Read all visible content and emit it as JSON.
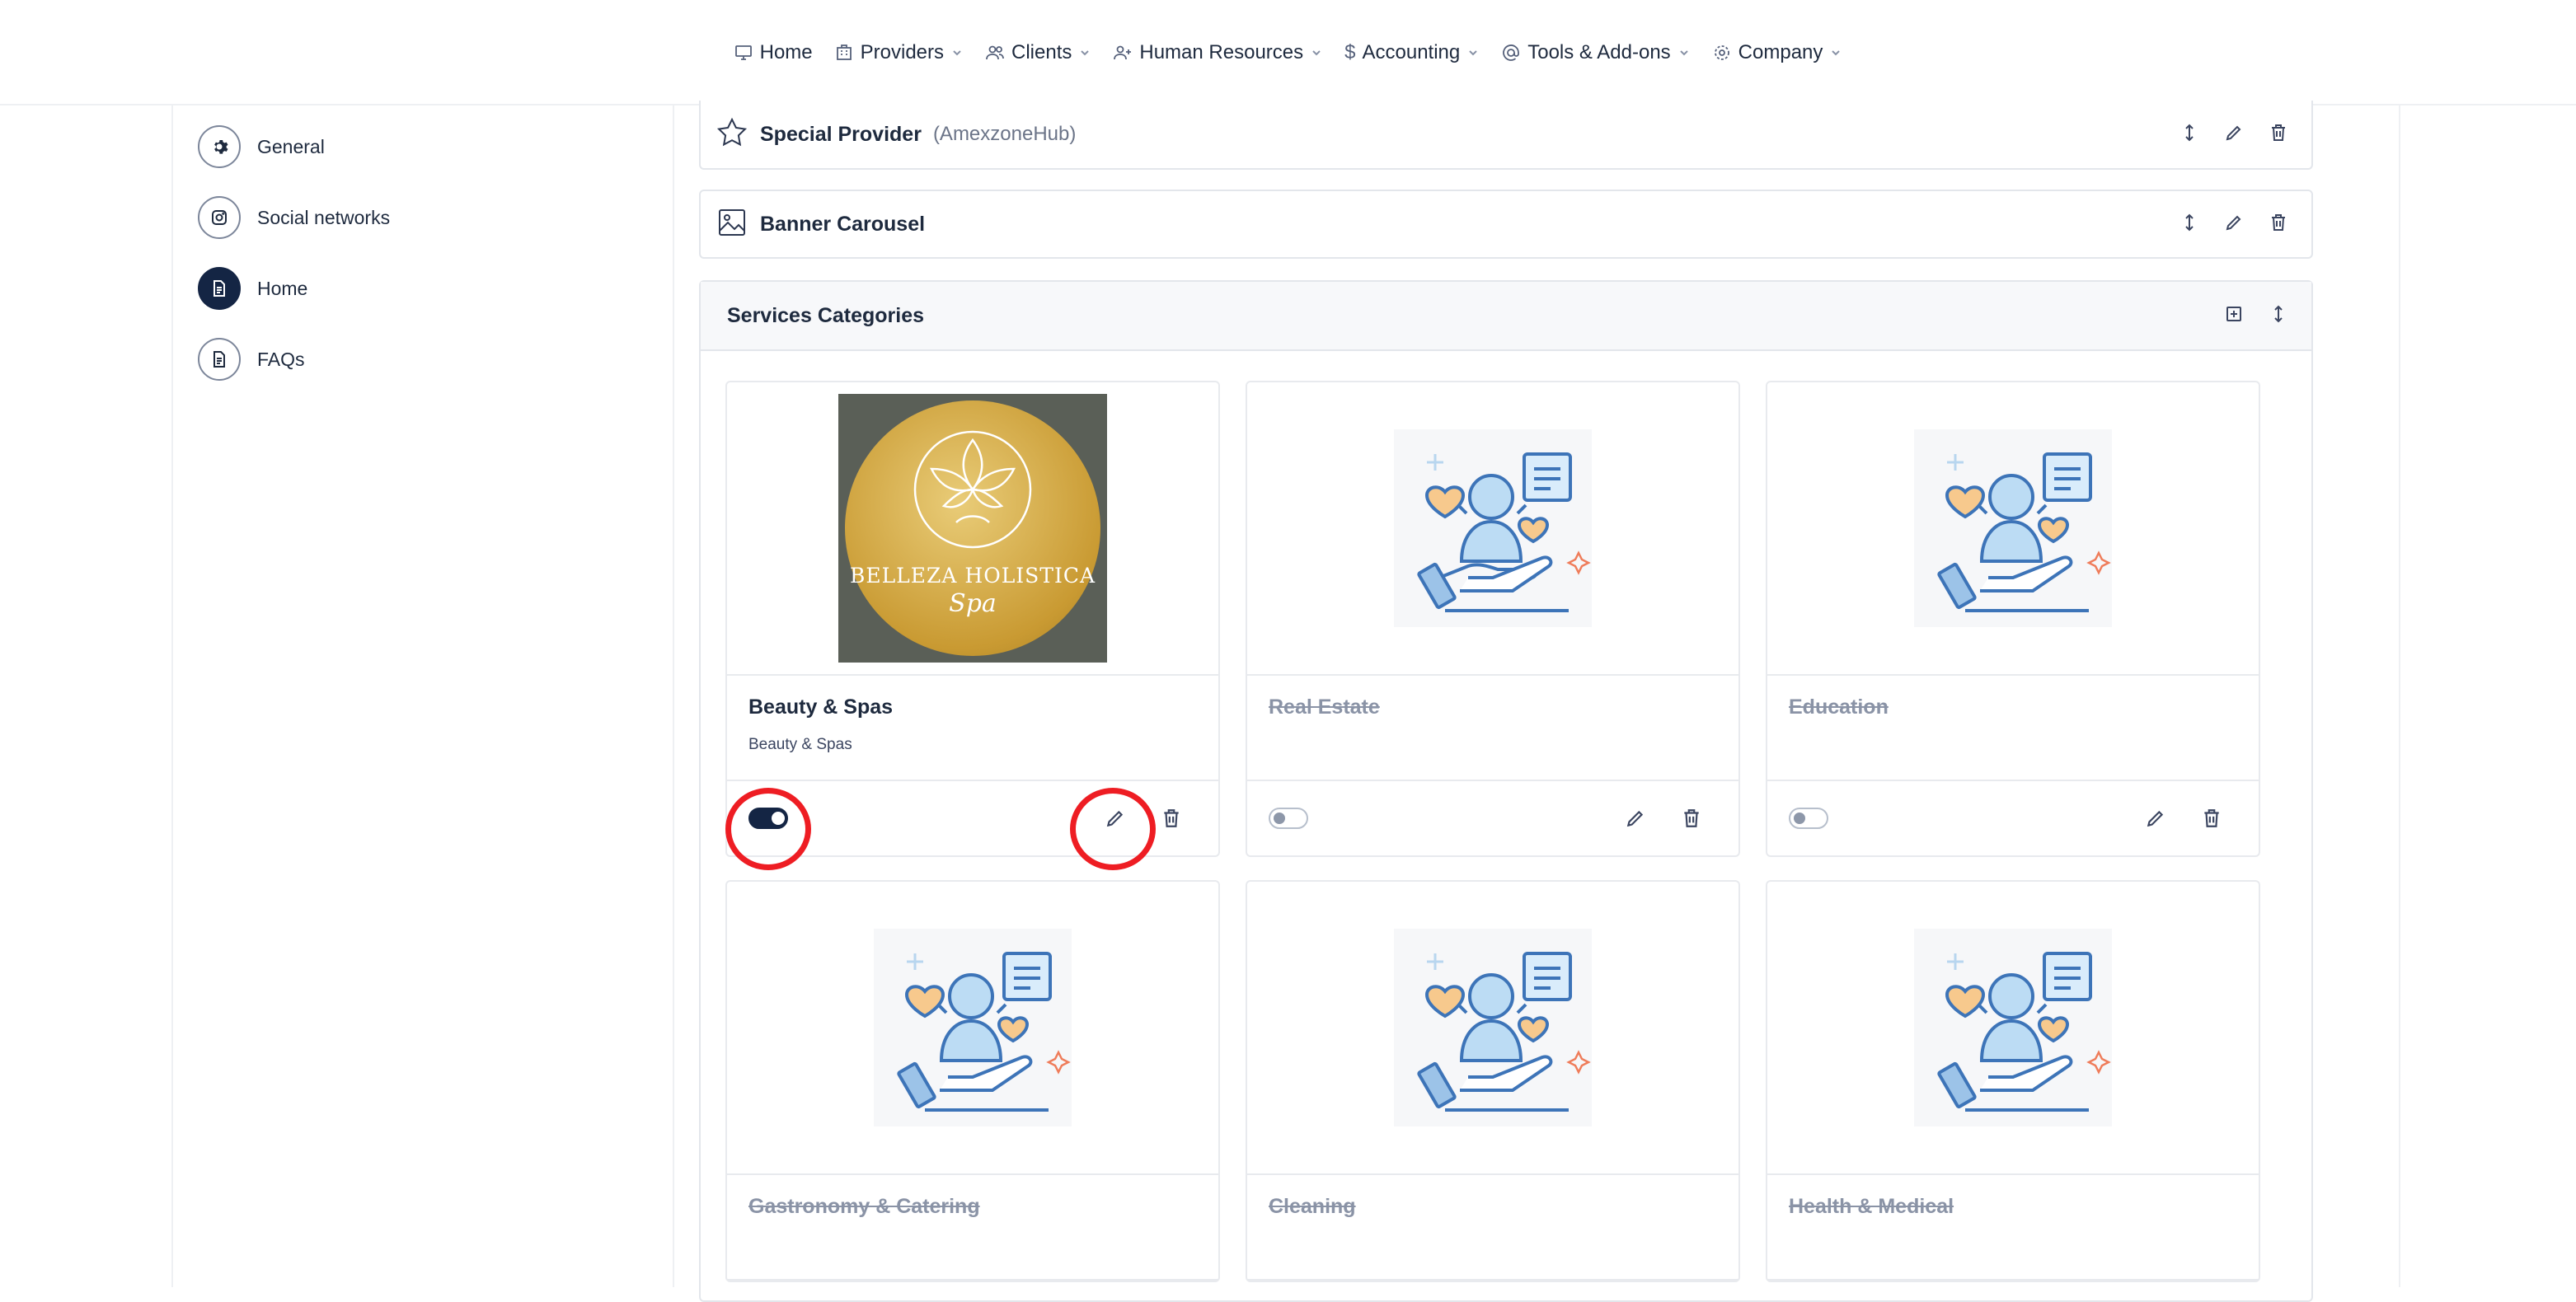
{
  "nav": {
    "items": [
      {
        "label": "Home",
        "icon": "monitor-icon",
        "dropdown": false
      },
      {
        "label": "Providers",
        "icon": "building-icon",
        "dropdown": true
      },
      {
        "label": "Clients",
        "icon": "users-icon",
        "dropdown": true
      },
      {
        "label": "Human Resources",
        "icon": "user-plus-icon",
        "dropdown": true
      },
      {
        "label": "Accounting",
        "icon": "dollar-icon",
        "dropdown": true
      },
      {
        "label": "Tools & Add-ons",
        "icon": "at-icon",
        "dropdown": true
      },
      {
        "label": "Company",
        "icon": "gear-icon",
        "dropdown": true
      }
    ],
    "dollar_glyph": "$"
  },
  "sidebar": {
    "items": [
      {
        "label": "General",
        "icon": "gear-icon",
        "active": false
      },
      {
        "label": "Social networks",
        "icon": "instagram-icon",
        "active": false
      },
      {
        "label": "Home",
        "icon": "document-icon",
        "active": true
      },
      {
        "label": "FAQs",
        "icon": "document-icon",
        "active": false
      }
    ]
  },
  "sections": {
    "special_provider": {
      "title": "Special Provider",
      "subtitle": "(AmexzoneHub)",
      "icon": "star-icon"
    },
    "banner_carousel": {
      "title": "Banner Carousel",
      "icon": "image-icon"
    },
    "services_categories": {
      "title": "Services Categories",
      "icon": "align-left-icon"
    }
  },
  "cards": [
    {
      "title": "Beauty & Spas",
      "subtitle": "Beauty & Spas",
      "enabled": true,
      "image": "belleza-holistica-logo"
    },
    {
      "title": "Real Estate",
      "subtitle": "",
      "enabled": false,
      "image": "service-illustration"
    },
    {
      "title": "Education",
      "subtitle": "",
      "enabled": false,
      "image": "service-illustration"
    },
    {
      "title": "Gastronomy & Catering",
      "subtitle": "",
      "enabled": false,
      "image": "service-illustration"
    },
    {
      "title": "Cleaning",
      "subtitle": "",
      "enabled": false,
      "image": "service-illustration"
    },
    {
      "title": "Health & Medical",
      "subtitle": "",
      "enabled": false,
      "image": "service-illustration"
    }
  ],
  "logo": {
    "line1": "BELLEZA HOLISTICA",
    "line2": "Spa"
  },
  "colors": {
    "annotation_red": "#ee1d23",
    "active_navy": "#142544"
  }
}
